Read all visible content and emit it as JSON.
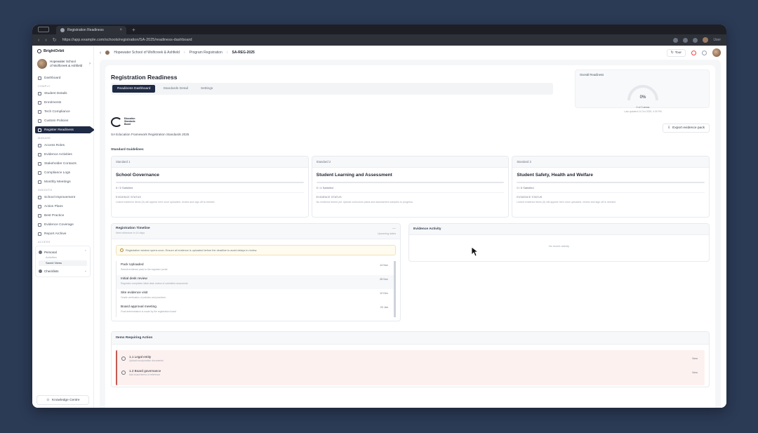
{
  "browser": {
    "tab_title": "Registration Readiness",
    "url": "https://app.example.com/schools/registration/SA-2025/readiness-dashboard",
    "profile_label": "User"
  },
  "app": {
    "brand": "BrightOrbit"
  },
  "sidebar": {
    "org_line1": "Hopewater School",
    "org_line2": "of Wolfcreek & Ashfield",
    "main_item": "Dashboard",
    "sections": [
      {
        "title": "COMPLY",
        "items": [
          "Student Details",
          "Enrolments",
          "Tech Compliance",
          "Custom Policies",
          "Register Readiness"
        ]
      },
      {
        "title": "MANAGE",
        "items": [
          "Access Roles",
          "Evidence Activities",
          "Stakeholder Contacts",
          "Compliance Logs",
          "Monthly Meetings"
        ]
      },
      {
        "title": "INSIGHTS",
        "items": [
          "School Improvement",
          "Action Plans",
          "Best Practice",
          "Evidence Coverage",
          "Report Archive"
        ]
      }
    ],
    "group_title": "ACCESS",
    "group1": {
      "label": "Personal",
      "sub": [
        "Activities",
        "Saved Views"
      ]
    },
    "group2": {
      "label": "Checklists"
    },
    "knowledge_center": "Knowledge Centre"
  },
  "topbar": {
    "crumb1": "Hopewater School of Wolfcreek & Ashfield",
    "crumb2": "Program Registration",
    "crumb3": "SA-REG-2025",
    "tour_label": "Tour"
  },
  "page": {
    "title": "Registration Readiness",
    "tabs": [
      "Readiness Dashboard",
      "Standards Detail",
      "Settings"
    ],
    "overall": {
      "label": "Overall Readiness",
      "percent": "0%",
      "sub": "0 of 3 areas",
      "sub2": "Last updated 14 Oct 2025, 4:30 PM"
    },
    "logo_text": "Education Standards Board",
    "framework": "SA Education Framework Registration Standards 2025",
    "export_label": "Export evidence pack",
    "section_label": "Standard Guidelines"
  },
  "standards": [
    {
      "code": "Standard 1",
      "title": "School Governance",
      "status": "0 / 5 Satisfied",
      "ev_head": "EVIDENCE STATUS",
      "note": "Linked evidence items (0) will appear here once uploaded, review and sign off is needed."
    },
    {
      "code": "Standard 2",
      "title": "Student Learning and Assessment",
      "status": "0 / 4 Satisfied",
      "ev_head": "EVIDENCE STATUS",
      "note": "No evidence linked yet. Upload curriculum plans and assessment samples to progress."
    },
    {
      "code": "Standard 3",
      "title": "Student Safety, Health and Welfare",
      "status": "0 / 6 Satisfied",
      "ev_head": "EVIDENCE STATUS",
      "note": "Linked evidence items (0) will appear here once uploaded, review and sign off is needed."
    }
  ],
  "timeline": {
    "title": "Registration Timeline",
    "sub": "Next milestone in 14 days",
    "dash": "—",
    "right_label": "Upcoming dates",
    "alert": "Registration window opens soon. Ensure all evidence is uploaded before the deadline to avoid delays in review.",
    "items": [
      {
        "label": "Pack Uploaded",
        "desc": "Submit evidence pack to the regulator portal",
        "date": "14 Nov"
      },
      {
        "label": "Initial desk review",
        "desc": "Regulator completes initial desk review of submitted documents",
        "date": "28 Nov"
      },
      {
        "label": "Site evidence visit",
        "desc": "Onsite verification of policies and practices",
        "date": "12 Dec"
      },
      {
        "label": "Board approval meeting",
        "desc": "Final determination is made by the registration board",
        "date": "20 Jan"
      }
    ]
  },
  "evidence": {
    "title": "Evidence Activity",
    "empty": "No recent activity"
  },
  "action_items": {
    "title": "Items Requiring Action",
    "rows": [
      {
        "title": "1.1 Legal entity",
        "sub": "Upload incorporation documents",
        "right": "New"
      },
      {
        "title": "1.2 Board governance",
        "sub": "Add board terms of reference",
        "right": "New"
      }
    ]
  }
}
